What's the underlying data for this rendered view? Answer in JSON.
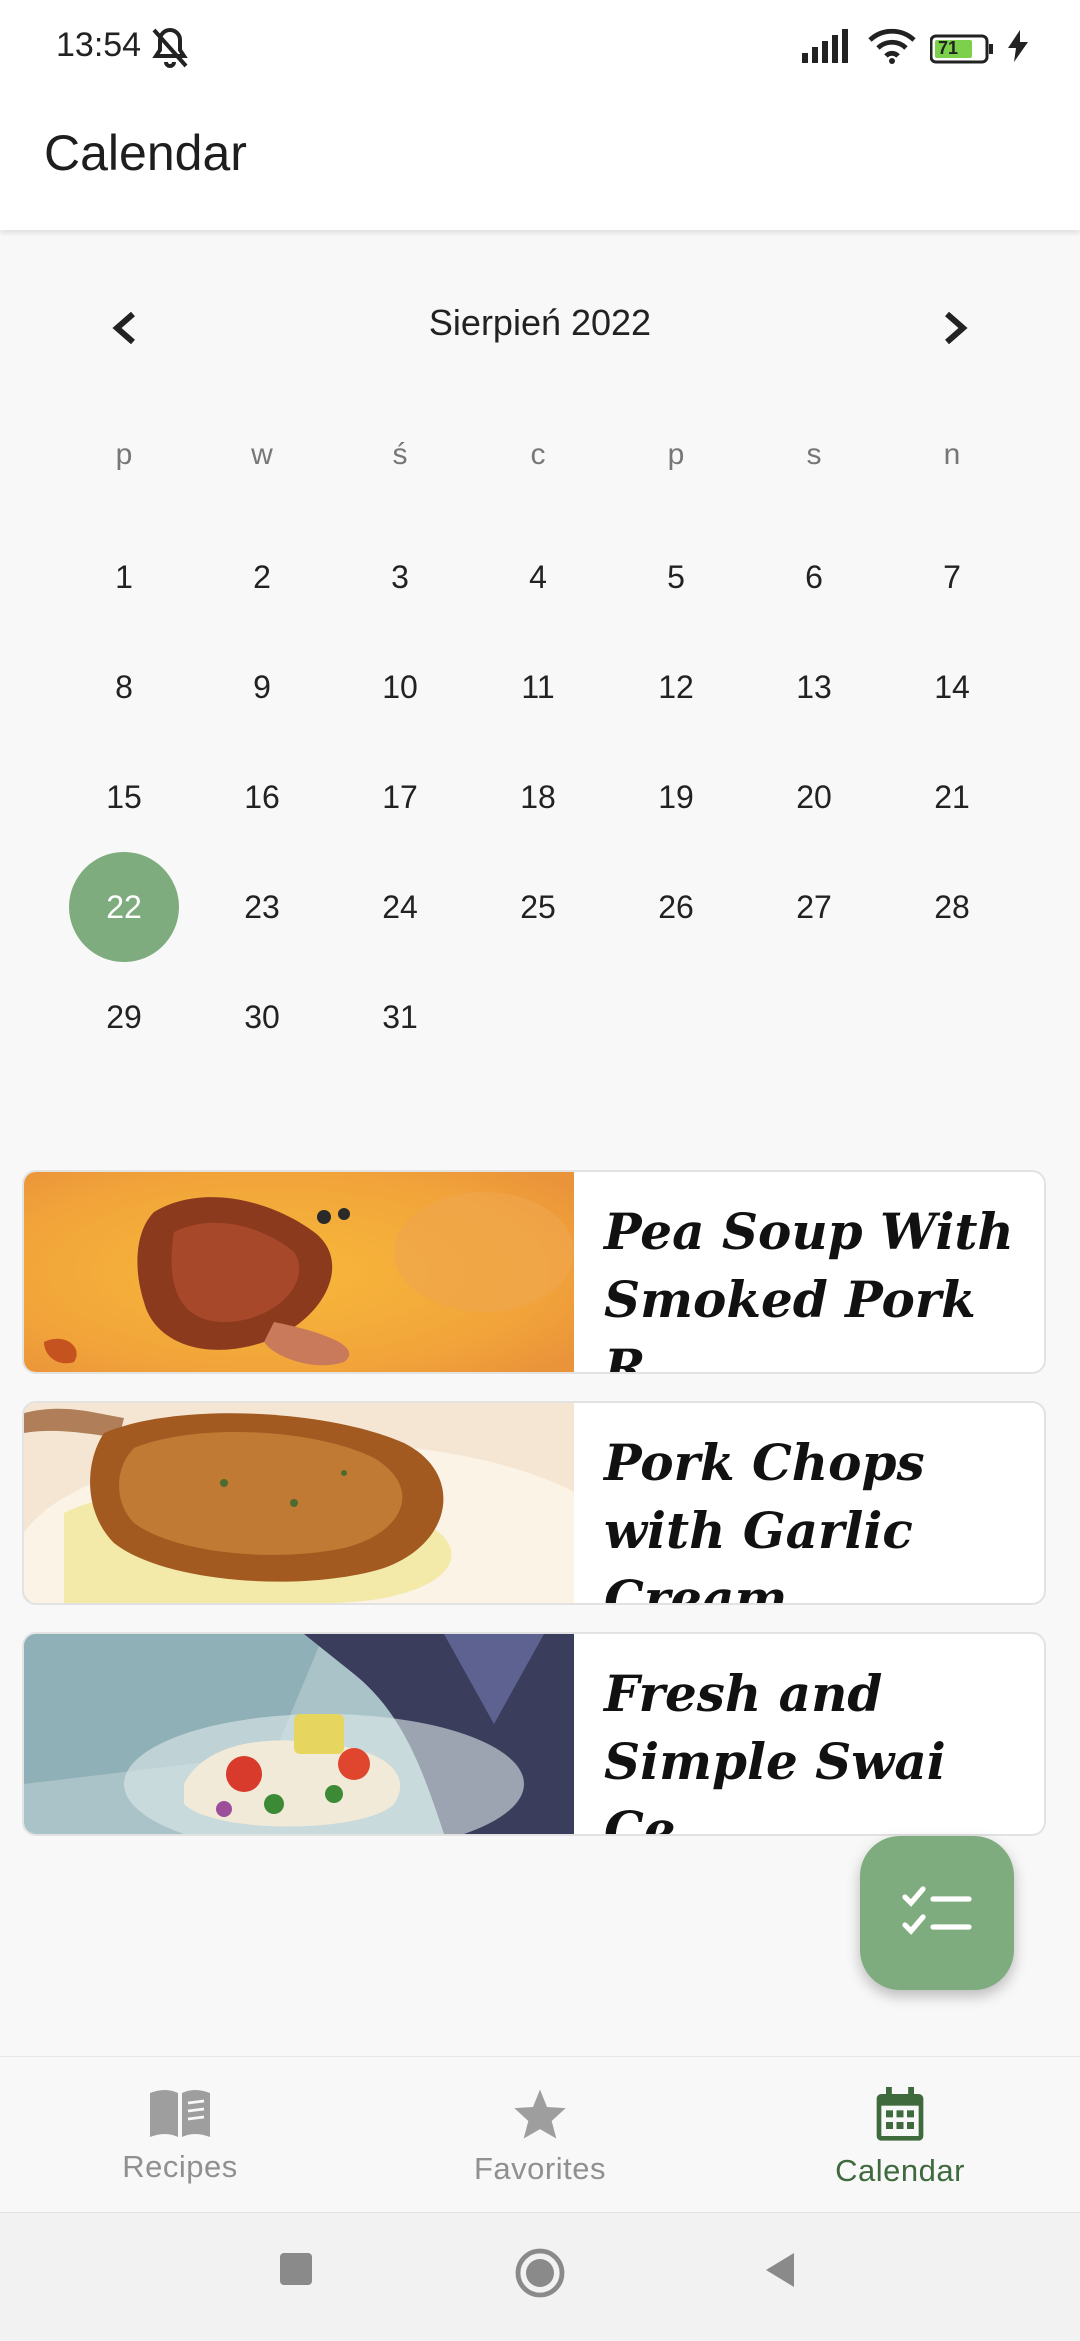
{
  "status_bar": {
    "time": "13:54",
    "battery": "71"
  },
  "app_bar": {
    "title": "Calendar"
  },
  "calendar": {
    "month_label": "Sierpień 2022",
    "weekdays": [
      "p",
      "w",
      "ś",
      "c",
      "p",
      "s",
      "n"
    ],
    "days": [
      "1",
      "2",
      "3",
      "4",
      "5",
      "6",
      "7",
      "8",
      "9",
      "10",
      "11",
      "12",
      "13",
      "14",
      "15",
      "16",
      "17",
      "18",
      "19",
      "20",
      "21",
      "22",
      "23",
      "24",
      "25",
      "26",
      "27",
      "28",
      "29",
      "30",
      "31"
    ],
    "selected_day": "22"
  },
  "recipes": [
    {
      "title": "Pea Soup With Smoked Pork R..."
    },
    {
      "title": "Pork Chops with Garlic Cream"
    },
    {
      "title": "Fresh and Simple Swai Ce..."
    }
  ],
  "bottom_nav": {
    "items": [
      {
        "label": "Recipes",
        "icon": "book-icon"
      },
      {
        "label": "Favorites",
        "icon": "star-icon"
      },
      {
        "label": "Calendar",
        "icon": "calendar-icon"
      }
    ],
    "active": "Calendar"
  },
  "colors": {
    "accent": "#7fac7f",
    "active_nav": "#3e6a3e",
    "inactive_nav": "#909090"
  }
}
